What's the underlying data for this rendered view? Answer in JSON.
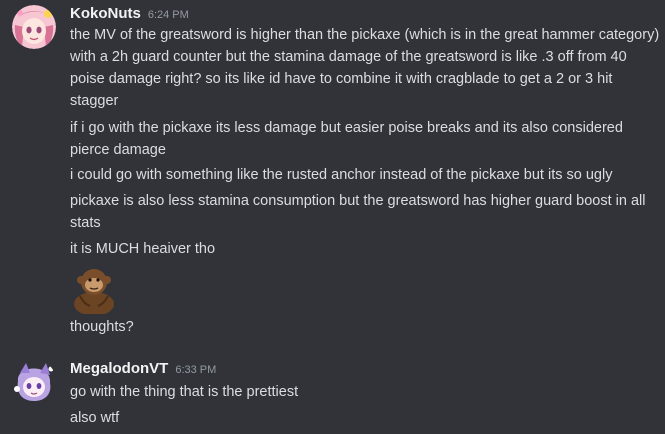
{
  "messages": [
    {
      "username": "KokoNuts",
      "timestamp": "6:24 PM",
      "avatar_icon": "anime-avatar-pink-hair",
      "lines": [
        "the MV of the greatsword is higher than the pickaxe (which is in the great hammer category) with a 2h guard counter but the stamina damage of the greatsword is like .3 off from 40 poise damage right? so its like id have to combine it with cragblade to get a 2 or 3 hit stagger",
        "if i go with the pickaxe its less damage but easier poise breaks and its also considered pierce damage",
        "i could go with something like the rusted anchor instead of the pickaxe but its so ugly",
        "pickaxe is also less stamina consumption but the greatsword has higher guard boost in all stats",
        "it is MUCH heaiver tho",
        "thoughts?"
      ],
      "emoji_icon": "thinking-monkey-emoji"
    },
    {
      "username": "MegalodonVT",
      "timestamp": "6:33 PM",
      "avatar_icon": "anime-avatar-purple-hair",
      "lines": [
        "go with the thing that is the prettiest",
        "also wtf"
      ]
    }
  ],
  "colors": {
    "background": "#313338",
    "text": "#dbdee1",
    "username": "#f2f3f5",
    "timestamp": "#949ba4"
  }
}
